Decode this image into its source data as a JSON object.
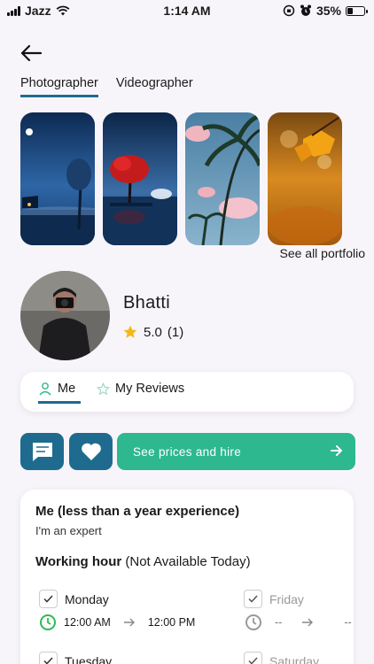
{
  "status_bar": {
    "carrier": "Jazz",
    "time": "1:14 AM",
    "battery_percent": "35%",
    "battery_level": 0.35
  },
  "tabs": [
    {
      "label": "Photographer",
      "active": true
    },
    {
      "label": "Videographer",
      "active": false
    }
  ],
  "portfolio": {
    "see_all_label": "See all portfolio"
  },
  "profile": {
    "name": "Bhatti",
    "rating": "5.0",
    "rating_count": "(1)"
  },
  "segment": {
    "me_label": "Me",
    "reviews_label": "My Reviews"
  },
  "actions": {
    "hire_label": "See prices and hire"
  },
  "about": {
    "title": "Me (less than a year experience)",
    "subtitle": "I'm an expert",
    "working_hour_label": "Working hour",
    "availability": "(Not Available Today)"
  },
  "schedule": [
    {
      "day": "Monday",
      "from": "12:00 AM",
      "to": "12:00 PM",
      "available": true
    },
    {
      "day": "Friday",
      "from": "--",
      "to": "--",
      "available": false
    },
    {
      "day": "Tuesday",
      "available": true
    },
    {
      "day": "Saturday",
      "available": false
    }
  ],
  "colors": {
    "primary": "#1e6b8f",
    "accent": "#2db88f",
    "star": "#f5b81c"
  }
}
